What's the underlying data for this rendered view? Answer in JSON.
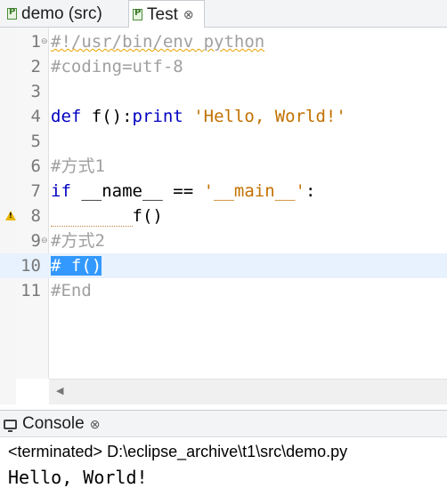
{
  "editor_tabs": [
    {
      "label": "demo (src)",
      "active": false,
      "icon": "python-file-icon"
    },
    {
      "label": "Test",
      "active": true,
      "icon": "python-file-icon",
      "close": "⊗"
    }
  ],
  "editor": {
    "line_numbers": [
      "1",
      "2",
      "3",
      "4",
      "5",
      "6",
      "7",
      "8",
      "9",
      "10",
      "11"
    ],
    "current_line": 10,
    "warning_line": 8,
    "lines": {
      "l1": "#!/usr/bin/env python",
      "l2": "#coding=utf-8",
      "l4_kw1": "def",
      "l4_mid": " f():",
      "l4_kw2": "print",
      "l4_str": "'Hello, World!'",
      "l6": "#方式1",
      "l7_kw": "if",
      "l7_mid": " __name__ == ",
      "l7_str": "'__main__'",
      "l7_end": ":",
      "l8": "f()",
      "l9": "#方式2",
      "l10": "# f()",
      "l11": "#End"
    }
  },
  "console": {
    "tab_label": "Console",
    "tab_close": "⊗",
    "header": "<terminated> D:\\eclipse_archive\\t1\\src\\demo.py",
    "output": "Hello, World!"
  },
  "colors": {
    "keyword": "#0000c0",
    "comment": "#a0a0a0",
    "string": "#c27100",
    "selection": "#3399ff",
    "current_line": "#e8f2fe"
  }
}
